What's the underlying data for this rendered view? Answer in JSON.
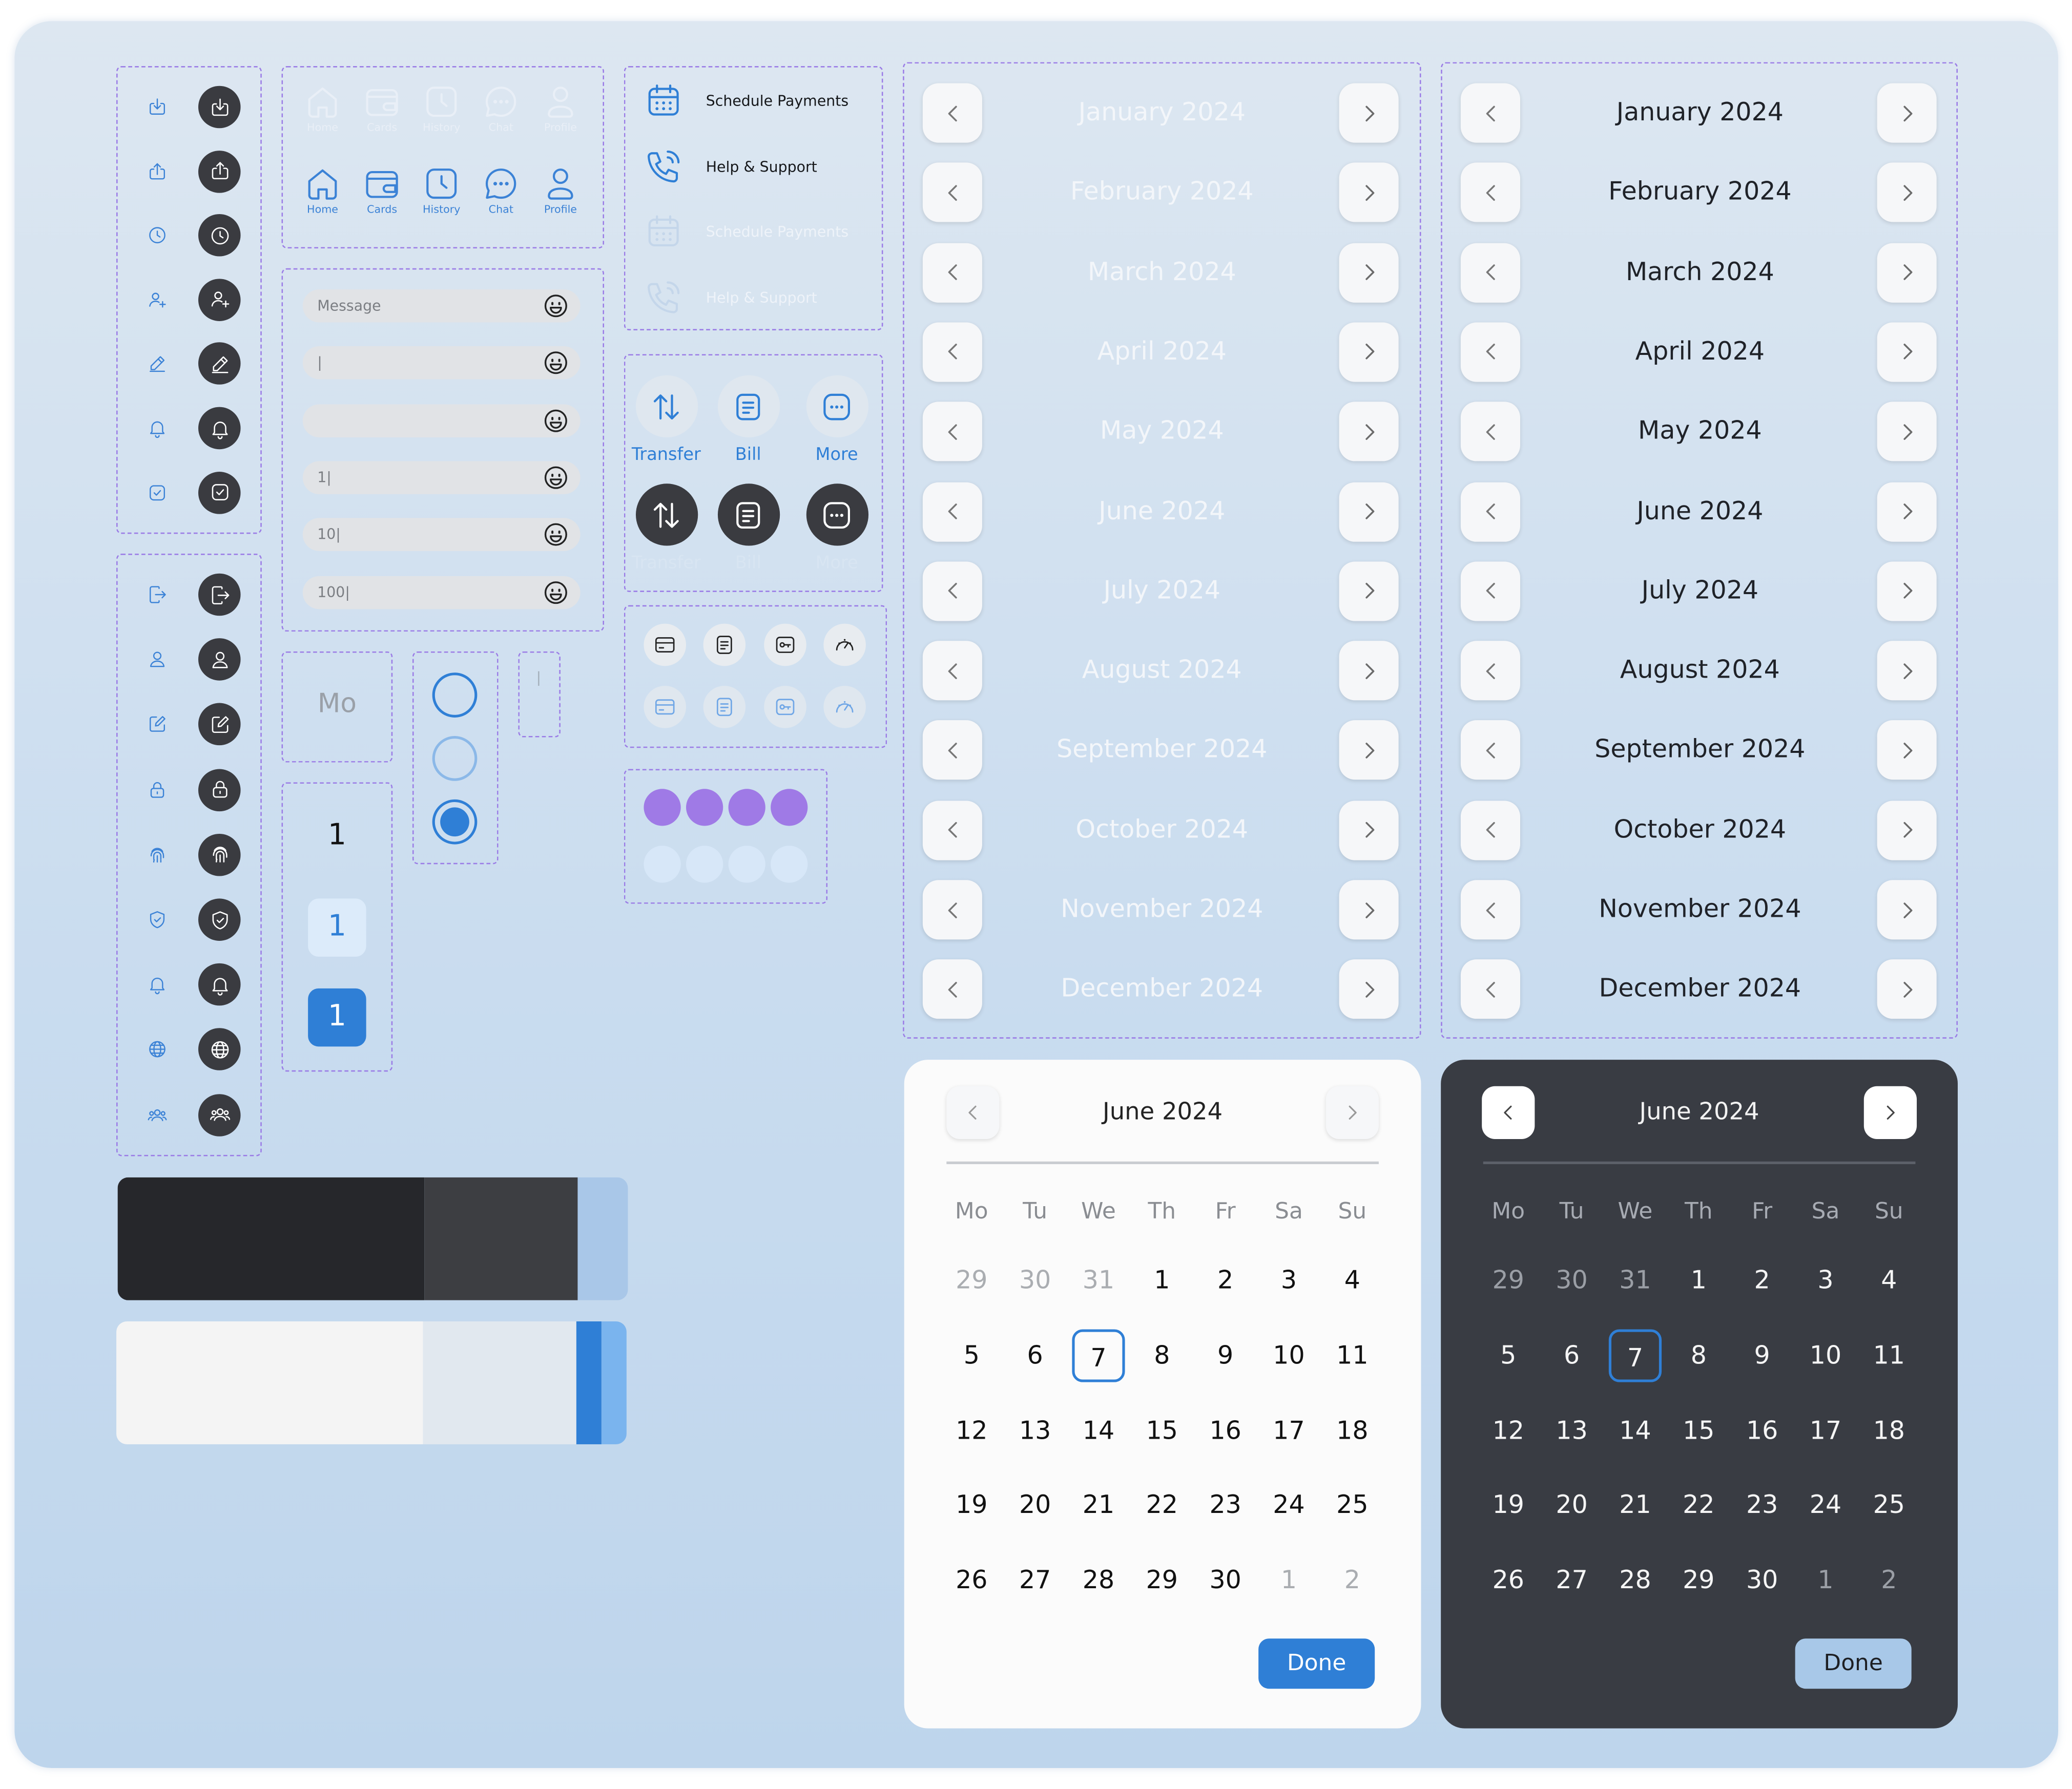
{
  "nav_icons": [
    "home-icon",
    "wallet-icon",
    "history-icon",
    "chat-icon",
    "profile-icon"
  ],
  "nav_labels": [
    "Home",
    "Cards",
    "History",
    "Chat",
    "Profile"
  ],
  "messages": [
    "Message",
    "|",
    "",
    "1|",
    "10|",
    "100|"
  ],
  "links": [
    "Schedule Payments",
    "Help & Support",
    "Schedule Payments",
    "Help & Support"
  ],
  "actions": [
    "Transfer",
    "Bill",
    "More",
    "Transfer",
    "Bill",
    "More"
  ],
  "day_abbr": "Mo",
  "counters": [
    "1",
    "1",
    "1"
  ],
  "months": [
    "January 2024",
    "February 2024",
    "March 2024",
    "April 2024",
    "May 2024",
    "June 2024",
    "July 2024",
    "August 2024",
    "September 2024",
    "October 2024",
    "November 2024",
    "December 2024"
  ],
  "calendar": {
    "title": "June 2024",
    "weekdays": [
      "Mo",
      "Tu",
      "We",
      "Th",
      "Fr",
      "Sa",
      "Su"
    ],
    "days": [
      "29",
      "30",
      "31",
      "1",
      "2",
      "3",
      "4",
      "5",
      "6",
      "7",
      "8",
      "9",
      "10",
      "11",
      "12",
      "13",
      "14",
      "15",
      "16",
      "17",
      "18",
      "19",
      "20",
      "21",
      "22",
      "23",
      "24",
      "25",
      "26",
      "27",
      "28",
      "29",
      "30",
      "1",
      "2"
    ],
    "selected": "7",
    "done": "Done"
  },
  "colors": {
    "accent": "#2f7fd6",
    "dark": "#3a3b40",
    "purple": "#9f7ae6",
    "light_blue": "#d7e7f8"
  }
}
